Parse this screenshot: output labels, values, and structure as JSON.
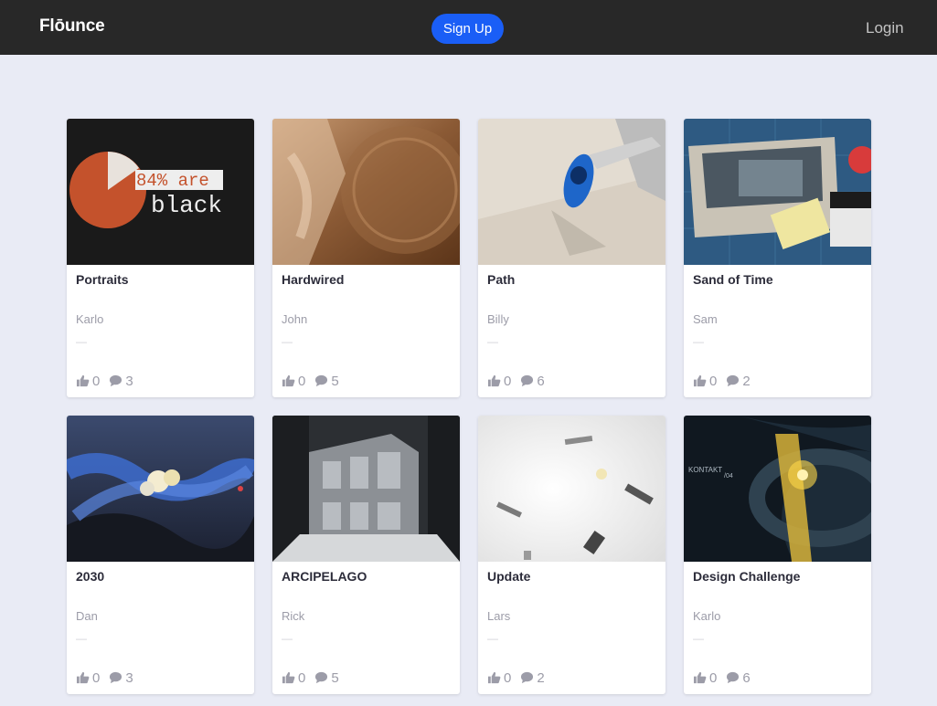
{
  "nav": {
    "brand": "Flōunce",
    "signup_label": "Sign Up",
    "login_label": "Login"
  },
  "cards": [
    {
      "title": "Portraits",
      "author": "Karlo",
      "meta": "—",
      "likes": "0",
      "comments": "3",
      "thumb": "pie-chart-poster"
    },
    {
      "title": "Hardwired",
      "author": "John",
      "meta": "—",
      "likes": "0",
      "comments": "5",
      "thumb": "us-seal-sculpture"
    },
    {
      "title": "Path",
      "author": "Billy",
      "meta": "—",
      "likes": "0",
      "comments": "6",
      "thumb": "blue-car-desert"
    },
    {
      "title": "Sand of Time",
      "author": "Sam",
      "meta": "—",
      "likes": "0",
      "comments": "2",
      "thumb": "retro-console"
    },
    {
      "title": "2030",
      "author": "Dan",
      "meta": "—",
      "likes": "0",
      "comments": "3",
      "thumb": "alien-landscape"
    },
    {
      "title": "ARCIPELAGO",
      "author": "Rick",
      "meta": "—",
      "likes": "0",
      "comments": "5",
      "thumb": "gray-architecture"
    },
    {
      "title": "Update",
      "author": "Lars",
      "meta": "—",
      "likes": "0",
      "comments": "2",
      "thumb": "white-space-objects"
    },
    {
      "title": "Design Challenge",
      "author": "Karlo",
      "meta": "—",
      "likes": "0",
      "comments": "6",
      "thumb": "dark-cockpit"
    }
  ],
  "thumb_text": {
    "poster_line1": "84% are",
    "poster_line2": "black",
    "cockpit_line1": "KONTAKT",
    "cockpit_line2": "/04"
  },
  "colors": {
    "nav_bg": "#282828",
    "accent": "#1a5ef6",
    "page_bg": "#e9ebf5"
  }
}
